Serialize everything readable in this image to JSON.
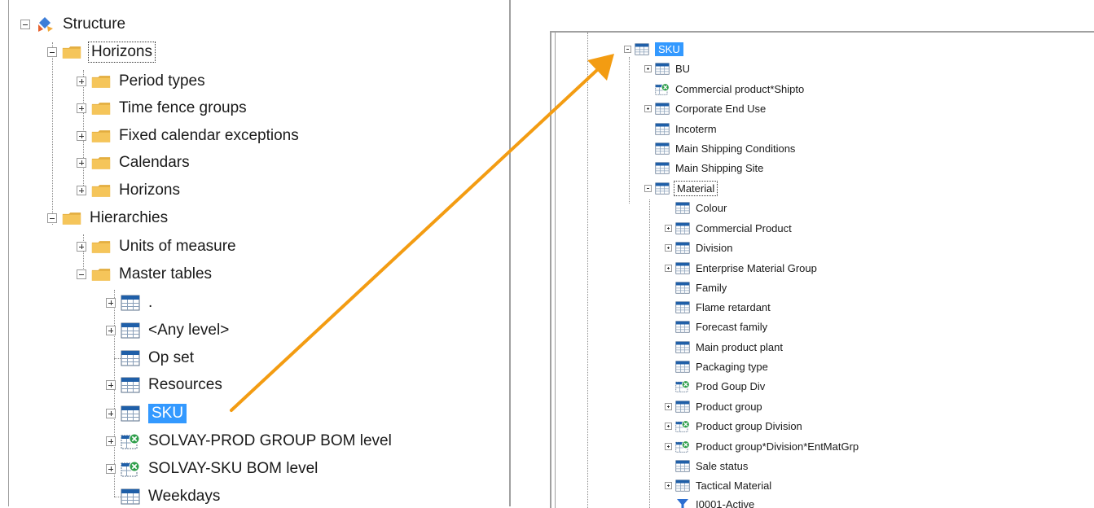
{
  "left_tree": {
    "root": "Structure",
    "horizons": "Horizons",
    "period_types": "Period types",
    "time_fence_groups": "Time fence groups",
    "fixed_calendar_exceptions": "Fixed calendar exceptions",
    "calendars": "Calendars",
    "horizons_child": "Horizons",
    "hierarchies": "Hierarchies",
    "units_of_measure": "Units of measure",
    "master_tables": "Master tables",
    "dot": ".",
    "any_level": "<Any level>",
    "op_set": "Op set",
    "resources": "Resources",
    "sku": "SKU",
    "solvay_prod_group_bom": "SOLVAY-PROD GROUP BOM level",
    "solvay_sku_bom": "SOLVAY-SKU BOM level",
    "weekdays": "Weekdays"
  },
  "right_tree": {
    "sku": "SKU",
    "bu": "BU",
    "commercial_product_shipto": "Commercial product*Shipto",
    "corporate_end_use": "Corporate End Use",
    "incoterm": "Incoterm",
    "main_shipping_conditions": "Main Shipping Conditions",
    "main_shipping_site": "Main Shipping Site",
    "material": "Material",
    "colour": "Colour",
    "commercial_product": "Commercial Product",
    "division": "Division",
    "enterprise_material_group": "Enterprise Material Group",
    "family": "Family",
    "flame_retardant": "Flame retardant",
    "forecast_family": "Forecast family",
    "main_product_plant": "Main product plant",
    "packaging_type": "Packaging type",
    "prod_goup_div": "Prod Goup Div",
    "product_group": "Product group",
    "product_group_division": "Product group Division",
    "product_group_division_entmatgrp": "Product group*Division*EntMatGrp",
    "sale_status": "Sale status",
    "tactical_material": "Tactical Material",
    "i0001_active": "I0001-Active"
  },
  "colors": {
    "selection": "#3399ff",
    "folder": "#f5c55a",
    "table_header": "#1f5fa8",
    "arrow": "#f39c12",
    "composite_badge": "#2e9e4a"
  }
}
